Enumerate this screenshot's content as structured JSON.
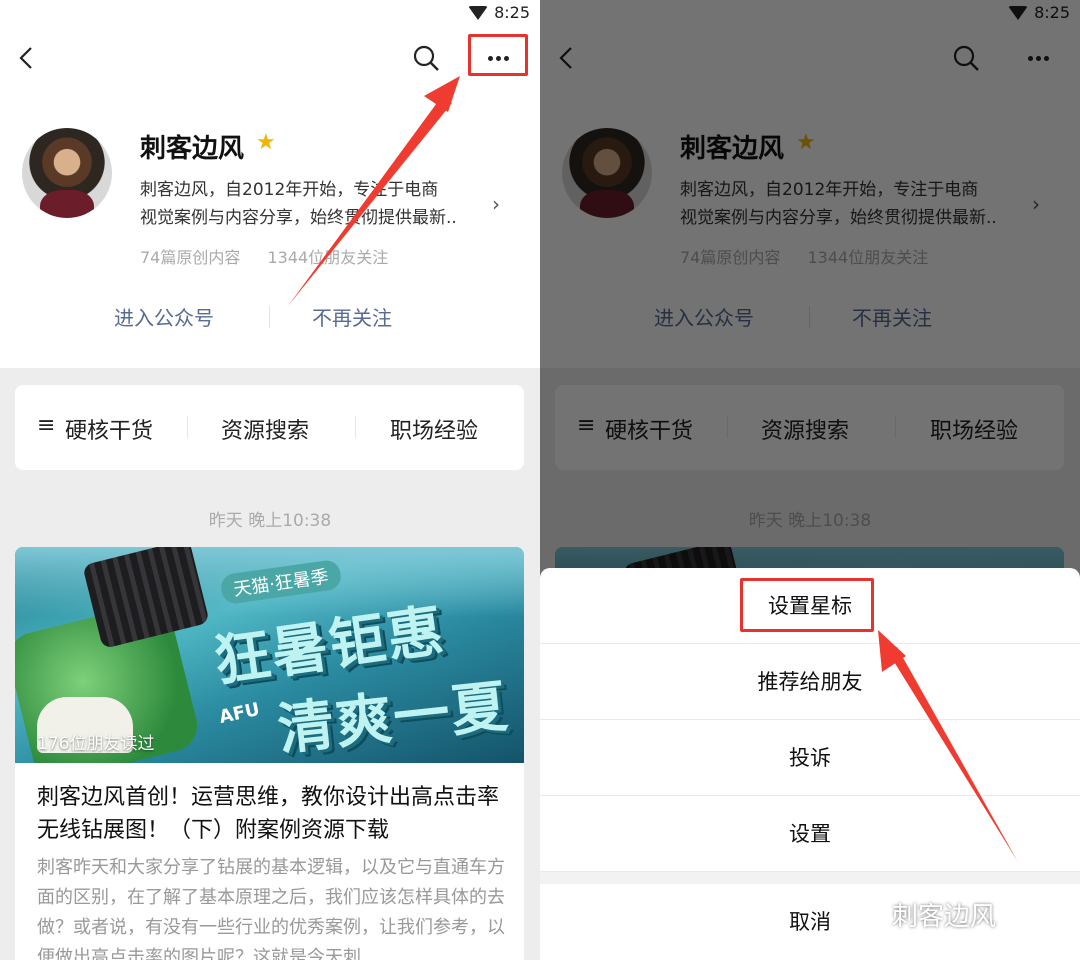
{
  "status": {
    "time": "8:25"
  },
  "profile": {
    "name": "刺客边风",
    "desc_line1": "刺客边风，自2012年开始，专注于电商",
    "desc_line2": "视觉案例与内容分享，始终贯彻提供最新..",
    "stats_articles": "74篇原创内容",
    "stats_followers": "1344位朋友关注",
    "enter_btn": "进入公众号",
    "unfollow_btn": "不再关注"
  },
  "menu": {
    "menu_icon": "≡",
    "items": [
      "硬核干货",
      "资源搜索",
      "职场经验"
    ]
  },
  "feed": {
    "timestamp": "昨天 晚上10:38",
    "banner_tag": "天猫·狂暑季",
    "banner_title1": "狂暑钜惠",
    "banner_title2": "清爽一夏",
    "banner_brand": "AFU",
    "reads": "176位朋友读过",
    "title": "刺客边风首创！运营思维，教你设计出高点击率无线钻展图！（下）附案例资源下载",
    "summary": "刺客昨天和大家分享了钻展的基本逻辑，以及它与直通车方面的区别，在了解了基本原理之后，我们应该怎样具体的去做？或者说，有没有一些行业的优秀案例，让我们参考，以便做出高点击率的图片呢？这就是今天刺"
  },
  "sheet": {
    "items": [
      "设置星标",
      "推荐给朋友",
      "投诉",
      "设置"
    ],
    "cancel": "取消"
  },
  "watermark": "刺客边风",
  "colors": {
    "link": "#576b95",
    "highlight": "#e8322d",
    "star": "#f2b409"
  },
  "icons": [
    "back-icon",
    "search-icon",
    "more-icon",
    "star-icon",
    "wifi-icon",
    "chevron-right-icon",
    "menu-icon",
    "wechat-icon"
  ]
}
